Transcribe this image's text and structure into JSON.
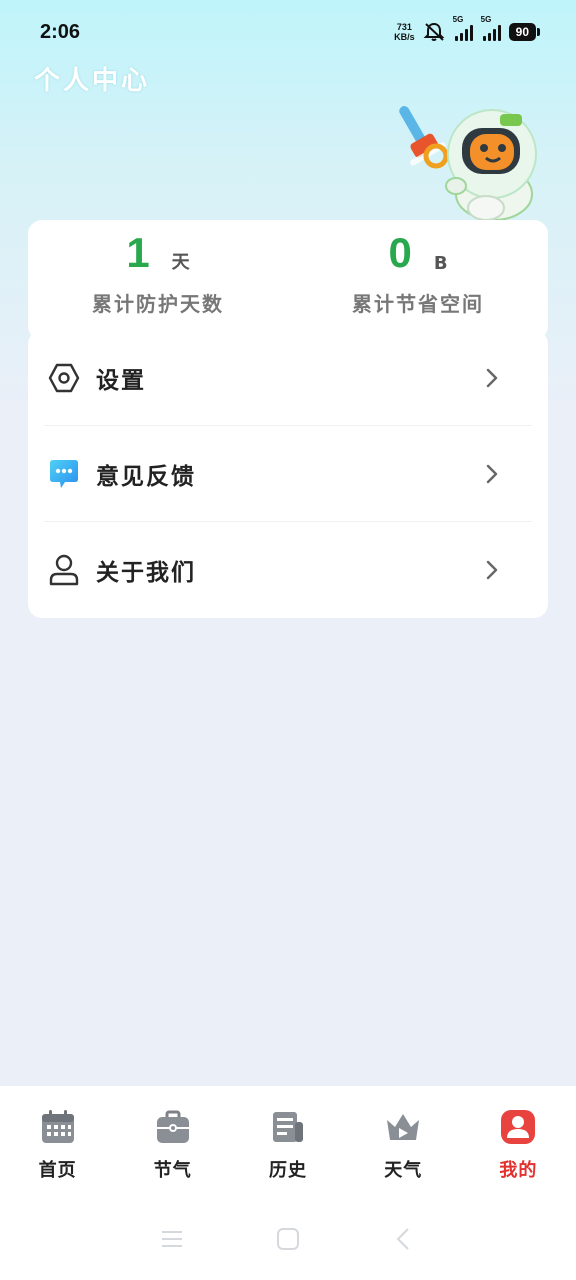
{
  "status_bar": {
    "time": "2:06",
    "net_speed_value": "731",
    "net_speed_unit": "KB/s",
    "sim1_label": "5G",
    "sim2_label": "5G",
    "battery": "90"
  },
  "page_title": "个人中心",
  "stats": {
    "days": {
      "value": "1",
      "unit": "天",
      "label": "累计防护天数"
    },
    "space": {
      "value": "0",
      "unit": "B",
      "label": "累计节省空间"
    }
  },
  "menu": {
    "items": [
      {
        "label": "设置",
        "icon": "settings-hexagon-icon"
      },
      {
        "label": "意见反馈",
        "icon": "feedback-chat-icon"
      },
      {
        "label": "关于我们",
        "icon": "user-icon"
      }
    ]
  },
  "bottom_nav": {
    "items": [
      {
        "label": "首页",
        "icon": "calendar-icon"
      },
      {
        "label": "节气",
        "icon": "toolbox-icon"
      },
      {
        "label": "历史",
        "icon": "newspaper-icon"
      },
      {
        "label": "天气",
        "icon": "crown-icon"
      },
      {
        "label": "我的",
        "icon": "profile-icon"
      }
    ],
    "active_index": 4
  },
  "colors": {
    "accent_green": "#2aa84e",
    "active_red": "#e2312f",
    "feedback_blue": "#2eb8f0"
  }
}
